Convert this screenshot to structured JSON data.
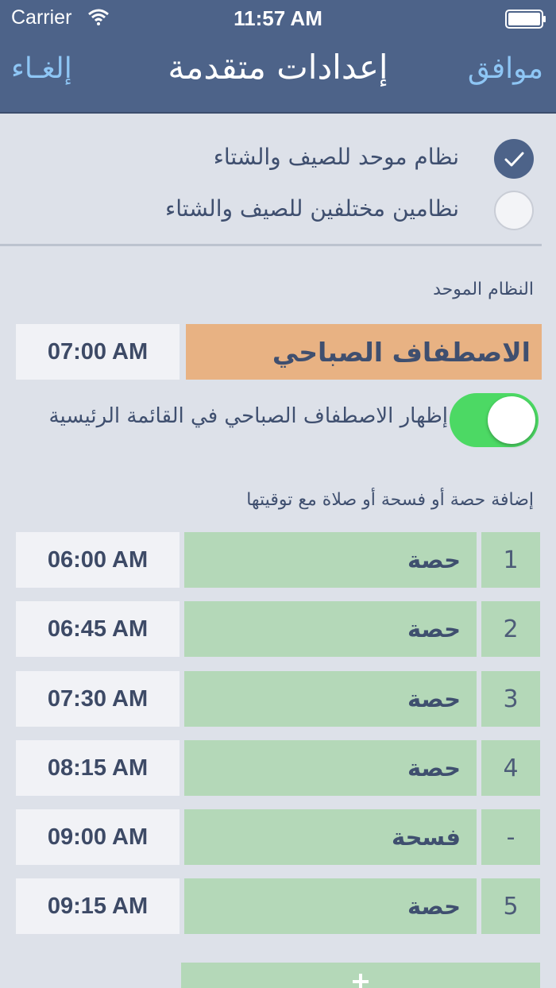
{
  "status": {
    "carrier": "Carrier",
    "time": "11:57 AM"
  },
  "nav": {
    "cancel": "إلغـاء",
    "title": "إعدادات متقدمة",
    "ok": "موافق"
  },
  "options": [
    {
      "label": "نظام موحد للصيف والشتاء",
      "checked": true
    },
    {
      "label": "نظامين مختلفين للصيف والشتاء",
      "checked": false
    }
  ],
  "unified": {
    "section_label": "النظام الموحد",
    "morning_name": "الاصطفاف الصباحي",
    "morning_time": "07:00 AM",
    "toggle_label": "إظهار الاصطفاف الصباحي في القائمة الرئيسية",
    "toggle_on": true
  },
  "schedule": {
    "section_label": "إضافة حصة أو فسحة أو صلاة مع توقيتها",
    "rows": [
      {
        "num": "1",
        "name": "حصة",
        "time": "06:00 AM"
      },
      {
        "num": "2",
        "name": "حصة",
        "time": "06:45 AM"
      },
      {
        "num": "3",
        "name": "حصة",
        "time": "07:30 AM"
      },
      {
        "num": "4",
        "name": "حصة",
        "time": "08:15 AM"
      },
      {
        "num": "-",
        "name": "فسحة",
        "time": "09:00 AM"
      },
      {
        "num": "5",
        "name": "حصة",
        "time": "09:15 AM"
      }
    ]
  },
  "colors": {
    "nav_bg": "#4d6389",
    "page_bg": "#dde1e9",
    "accent_link": "#8ec6f5",
    "row_green": "#b4d8b8",
    "morning_orange": "#e8b283",
    "toggle_green": "#4cd964"
  },
  "icons": {
    "wifi": "wifi-icon",
    "battery": "battery-icon",
    "check": "checkmark-icon",
    "plus": "plus-icon"
  }
}
